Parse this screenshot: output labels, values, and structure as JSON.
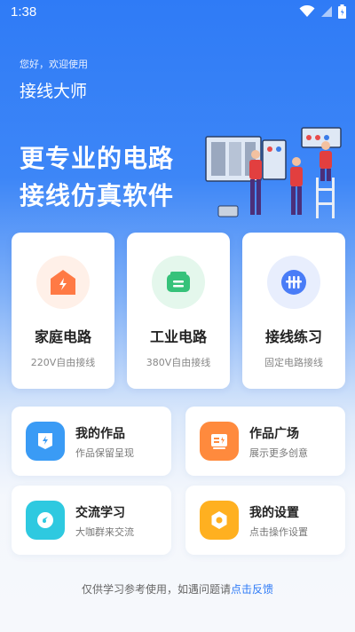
{
  "status_bar": {
    "time": "1:38",
    "icons": [
      "wifi-icon",
      "signal-icon",
      "battery-icon"
    ]
  },
  "header": {
    "greeting": "您好，欢迎使用",
    "app_title": "接线大师"
  },
  "hero": {
    "line1": "更专业的电路",
    "line2": "接线仿真软件"
  },
  "cards": [
    {
      "title": "家庭电路",
      "subtitle": "220V自由接线",
      "icon": "home-circuit-icon",
      "color": "#ff7a45"
    },
    {
      "title": "工业电路",
      "subtitle": "380V自由接线",
      "icon": "industrial-circuit-icon",
      "color": "#36c27a"
    },
    {
      "title": "接线练习",
      "subtitle": "固定电路接线",
      "icon": "wiring-practice-icon",
      "color": "#4a7df7"
    }
  ],
  "tiles": [
    {
      "title": "我的作品",
      "subtitle": "作品保留呈现",
      "icon": "my-works-icon",
      "color": "#3a9bf5"
    },
    {
      "title": "作品广场",
      "subtitle": "展示更多创意",
      "icon": "works-plaza-icon",
      "color": "#ff8a3d"
    },
    {
      "title": "交流学习",
      "subtitle": "大咖群来交流",
      "icon": "community-icon",
      "color": "#2ec9e0"
    },
    {
      "title": "我的设置",
      "subtitle": "点击操作设置",
      "icon": "settings-icon",
      "color": "#ffb020"
    }
  ],
  "footer": {
    "text": "仅供学习参考使用，如遇问题请",
    "link": "点击反馈"
  }
}
